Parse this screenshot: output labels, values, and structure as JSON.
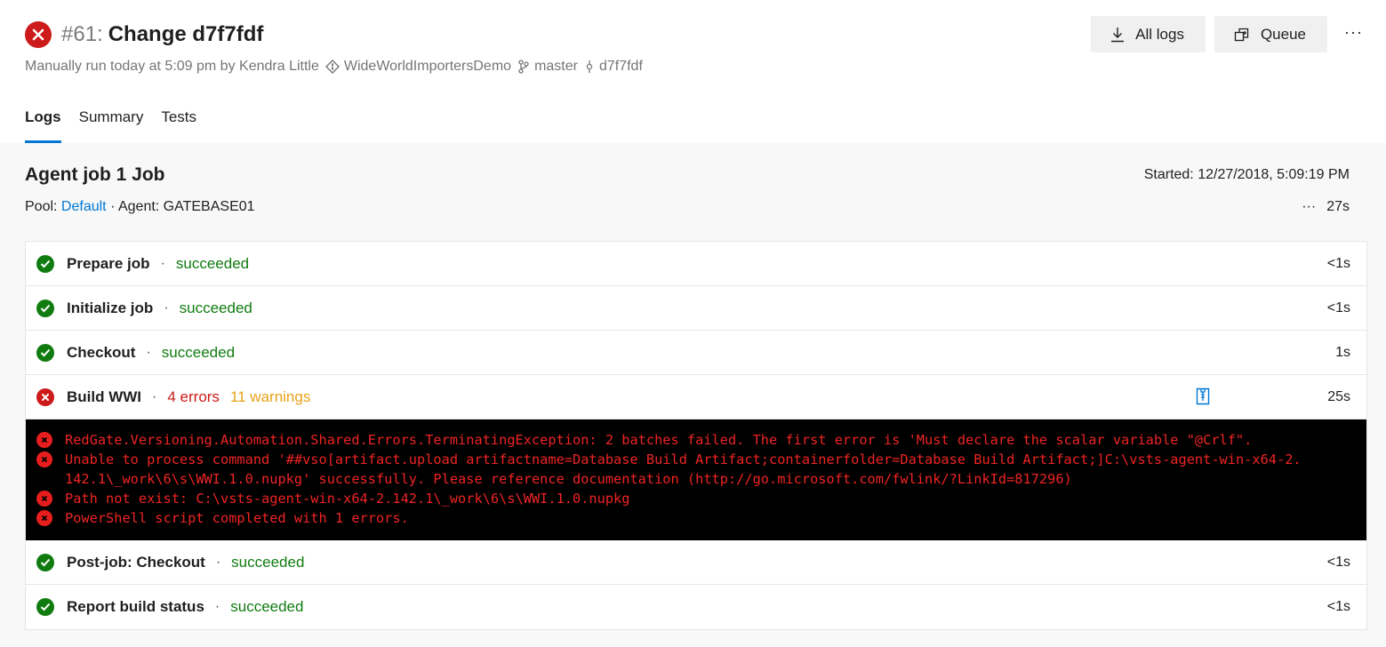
{
  "header": {
    "run_id": "#61:",
    "title": "Change d7f7fdf",
    "subtitle_trigger": "Manually run today at 5:09 pm by Kendra Little",
    "repo": "WideWorldImportersDemo",
    "branch": "master",
    "commit": "d7f7fdf",
    "all_logs_label": "All logs",
    "queue_label": "Queue",
    "more_label": "···"
  },
  "tabs": [
    {
      "label": "Logs",
      "active": true
    },
    {
      "label": "Summary",
      "active": false
    },
    {
      "label": "Tests",
      "active": false
    }
  ],
  "job": {
    "title": "Agent job 1 Job",
    "started": "Started: 12/27/2018, 5:09:19 PM",
    "pool_label": "Pool:",
    "pool_value": "Default",
    "agent": "· Agent: GATEBASE01",
    "more": "···",
    "duration": "27s"
  },
  "separator": "·",
  "steps": [
    {
      "name": "Prepare job",
      "status": "succeeded",
      "duration": "<1s"
    },
    {
      "name": "Initialize job",
      "status": "succeeded",
      "duration": "<1s"
    },
    {
      "name": "Checkout",
      "status": "succeeded",
      "duration": "1s"
    },
    {
      "name": "Build WWI",
      "errors": "4 errors",
      "warnings": "11 warnings",
      "duration": "25s"
    },
    {
      "name": "Post-job: Checkout",
      "status": "succeeded",
      "duration": "<1s"
    },
    {
      "name": "Report build status",
      "status": "succeeded",
      "duration": "<1s"
    }
  ],
  "console_lines": [
    "RedGate.Versioning.Automation.Shared.Errors.TerminatingException: 2 batches failed. The first error is 'Must declare the scalar variable \"@Crlf\".",
    "Unable to process command '##vso[artifact.upload artifactname=Database Build Artifact;containerfolder=Database Build Artifact;]C:\\vsts-agent-win-x64-2.",
    "142.1\\_work\\6\\s\\WWI.1.0.nupkg' successfully. Please reference documentation (http://go.microsoft.com/fwlink/?LinkId=817296)",
    "Path not exist: C:\\vsts-agent-win-x64-2.142.1\\_work\\6\\s\\WWI.1.0.nupkg",
    "PowerShell script completed with 1 errors."
  ],
  "colors": {
    "success": "#107c10",
    "error": "#cd1a1a",
    "warning": "#e8a317",
    "accent": "#0078d4"
  }
}
